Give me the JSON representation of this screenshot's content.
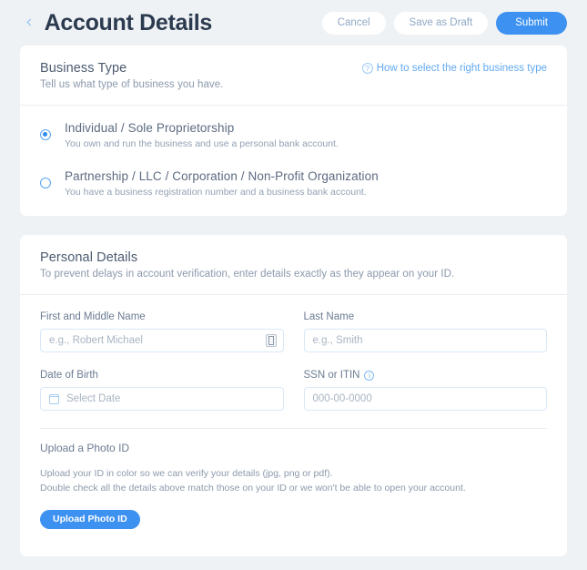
{
  "header": {
    "back_icon": "chevron-left-icon",
    "title": "Account Details",
    "cancel_label": "Cancel",
    "save_draft_label": "Save as Draft",
    "submit_label": "Submit",
    "accent_color": "#3d91f0"
  },
  "business_type": {
    "title": "Business Type",
    "subtitle": "Tell us what type of business you have.",
    "help_icon": "question-circle-icon",
    "help_label": "How to select the right business type",
    "options": [
      {
        "label": "Individual / Sole Proprietorship",
        "description": "You own and run the business and use a personal bank account.",
        "selected": true
      },
      {
        "label": "Partnership / LLC / Corporation / Non-Profit Organization",
        "description": "You have a business registration number and a business bank account.",
        "selected": false
      }
    ]
  },
  "personal_details": {
    "title": "Personal Details",
    "subtitle": "To prevent delays in account verification, enter details exactly as they appear on your ID.",
    "fields": {
      "first_name": {
        "label": "First and Middle Name",
        "placeholder": "e.g., Robert Michael",
        "value": "",
        "badge_icon": "input-indicator-icon"
      },
      "last_name": {
        "label": "Last Name",
        "placeholder": "e.g., Smith",
        "value": ""
      },
      "date_of_birth": {
        "label": "Date of Birth",
        "placeholder": "Select Date",
        "value": "",
        "icon": "calendar-icon"
      },
      "ssn": {
        "label": "SSN or ITIN",
        "info_icon": "info-circle-icon",
        "placeholder": "000-00-0000",
        "value": ""
      }
    },
    "upload": {
      "title": "Upload a Photo ID",
      "line1": "Upload your ID in color so we can verify your details (jpg, png or pdf).",
      "line2": "Double check all the details above match those on your ID or we won't be able to open your account.",
      "button_label": "Upload Photo ID"
    }
  }
}
